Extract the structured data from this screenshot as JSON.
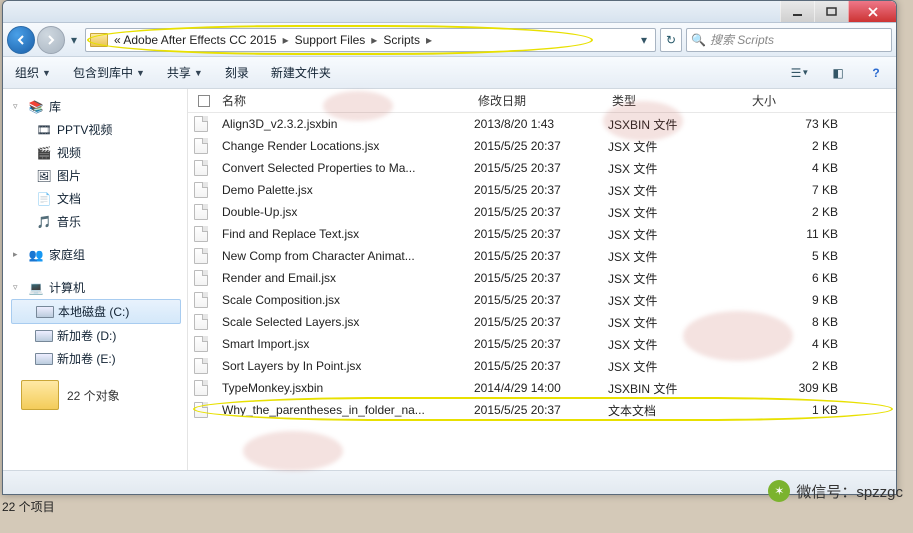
{
  "breadcrumbs": [
    "« Adobe After Effects CC 2015",
    "Support Files",
    "Scripts"
  ],
  "search_placeholder": "搜索 Scripts",
  "toolbar": {
    "organize": "组织",
    "include": "包含到库中",
    "share": "共享",
    "burn": "刻录",
    "newfolder": "新建文件夹"
  },
  "columns": {
    "name": "名称",
    "modified": "修改日期",
    "type": "类型",
    "size": "大小"
  },
  "sidebar": {
    "library": "库",
    "pptv": "PPTV视频",
    "video": "视频",
    "pictures": "图片",
    "documents": "文档",
    "music": "音乐",
    "homegroup": "家庭组",
    "computer": "计算机",
    "drive_c": "本地磁盘 (C:)",
    "drive_d": "新加卷 (D:)",
    "drive_e": "新加卷 (E:)"
  },
  "files": [
    {
      "name": "Align3D_v2.3.2.jsxbin",
      "modified": "2013/8/20 1:43",
      "type": "JSXBIN 文件",
      "size": "73 KB"
    },
    {
      "name": "Change Render Locations.jsx",
      "modified": "2015/5/25 20:37",
      "type": "JSX 文件",
      "size": "2 KB"
    },
    {
      "name": "Convert Selected Properties to Ma...",
      "modified": "2015/5/25 20:37",
      "type": "JSX 文件",
      "size": "4 KB"
    },
    {
      "name": "Demo Palette.jsx",
      "modified": "2015/5/25 20:37",
      "type": "JSX 文件",
      "size": "7 KB"
    },
    {
      "name": "Double-Up.jsx",
      "modified": "2015/5/25 20:37",
      "type": "JSX 文件",
      "size": "2 KB"
    },
    {
      "name": "Find and Replace Text.jsx",
      "modified": "2015/5/25 20:37",
      "type": "JSX 文件",
      "size": "11 KB"
    },
    {
      "name": "New Comp from Character Animat...",
      "modified": "2015/5/25 20:37",
      "type": "JSX 文件",
      "size": "5 KB"
    },
    {
      "name": "Render and Email.jsx",
      "modified": "2015/5/25 20:37",
      "type": "JSX 文件",
      "size": "6 KB"
    },
    {
      "name": "Scale Composition.jsx",
      "modified": "2015/5/25 20:37",
      "type": "JSX 文件",
      "size": "9 KB"
    },
    {
      "name": "Scale Selected Layers.jsx",
      "modified": "2015/5/25 20:37",
      "type": "JSX 文件",
      "size": "8 KB"
    },
    {
      "name": "Smart Import.jsx",
      "modified": "2015/5/25 20:37",
      "type": "JSX 文件",
      "size": "4 KB"
    },
    {
      "name": "Sort Layers by In Point.jsx",
      "modified": "2015/5/25 20:37",
      "type": "JSX 文件",
      "size": "2 KB"
    },
    {
      "name": "TypeMonkey.jsxbin",
      "modified": "2014/4/29 14:00",
      "type": "JSXBIN 文件",
      "size": "309 KB"
    },
    {
      "name": "Why_the_parentheses_in_folder_na...",
      "modified": "2015/5/25 20:37",
      "type": "文本文档",
      "size": "1 KB"
    }
  ],
  "preview_count": "22 个对象",
  "desk_status": "22 个项目",
  "wechat_label": "微信号：spzzgc"
}
